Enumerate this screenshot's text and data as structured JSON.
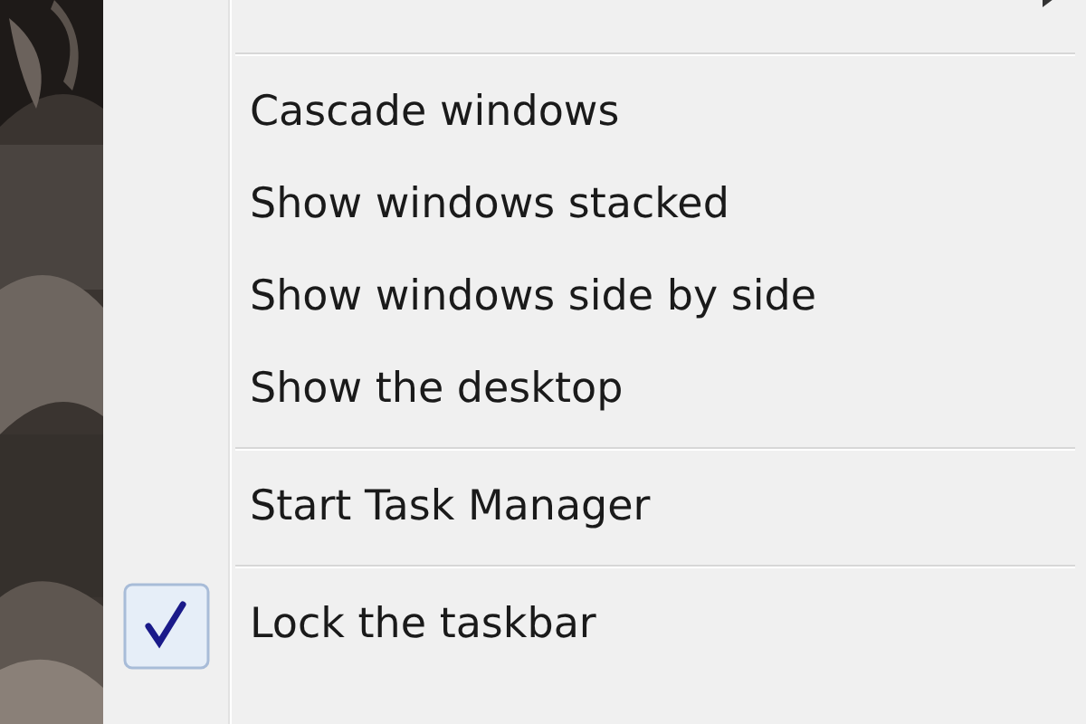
{
  "menu": {
    "items": [
      {
        "kind": "item",
        "checked": false,
        "submenu": true
      },
      {
        "kind": "separator"
      },
      {
        "kind": "item",
        "label": "Cascade windows",
        "checked": false,
        "submenu": false
      },
      {
        "kind": "item",
        "label": "Show windows stacked",
        "checked": false,
        "submenu": false
      },
      {
        "kind": "item",
        "label": "Show windows side by side",
        "checked": false,
        "submenu": false
      },
      {
        "kind": "item",
        "label": "Show the desktop",
        "checked": false,
        "submenu": false
      },
      {
        "kind": "separator"
      },
      {
        "kind": "item",
        "label": "Start Task Manager",
        "checked": false,
        "submenu": false
      },
      {
        "kind": "separator"
      },
      {
        "kind": "item",
        "label": "Lock the taskbar",
        "checked": true,
        "submenu": false
      }
    ]
  }
}
